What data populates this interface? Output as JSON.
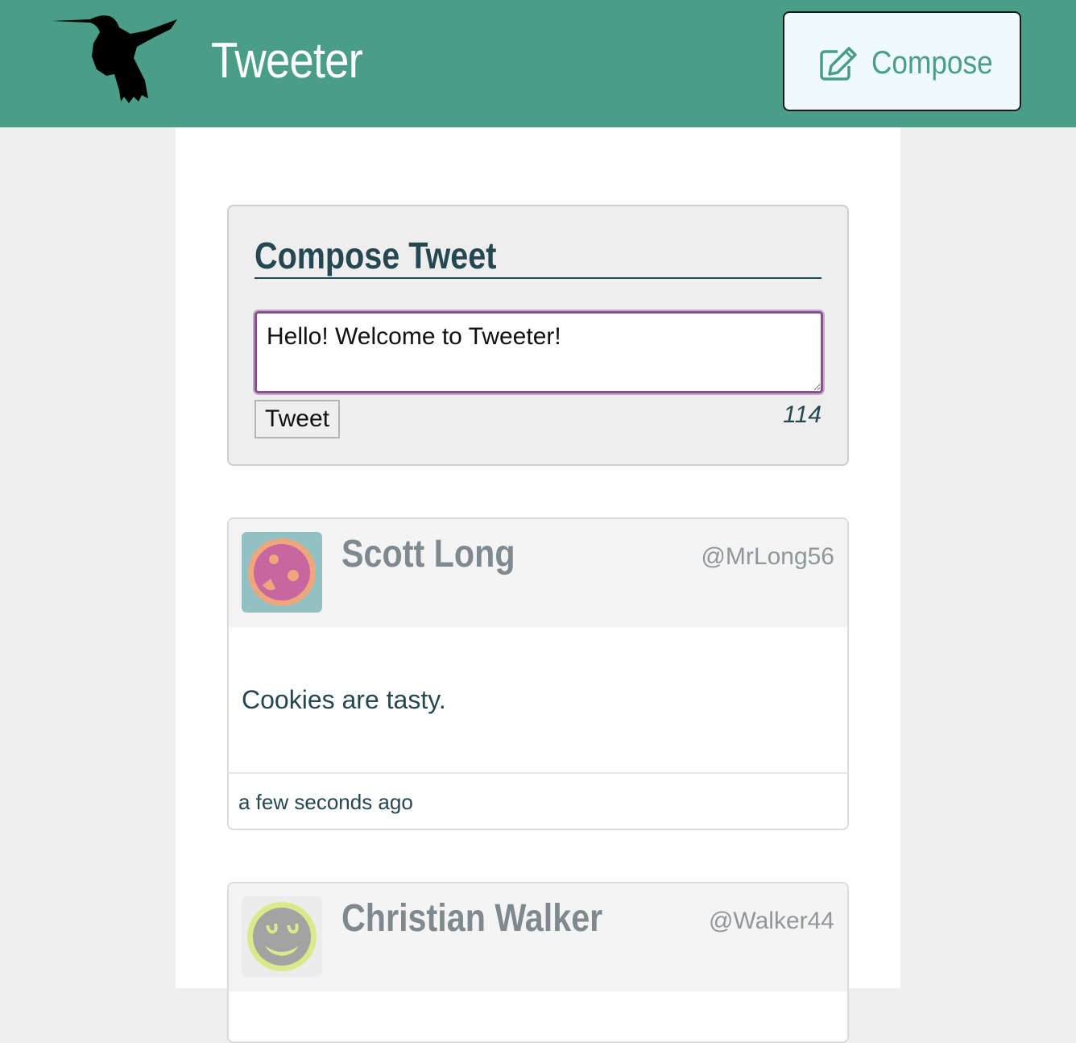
{
  "nav": {
    "brand": "Tweeter",
    "compose_label": "Compose"
  },
  "new_tweet": {
    "title": "Compose Tweet",
    "text": "Hello! Welcome to Tweeter!",
    "submit_label": "Tweet",
    "char_counter": "114"
  },
  "tweets": [
    {
      "name": "Scott Long",
      "handle": "@MrLong56",
      "content": "Cookies are tasty.",
      "time": "a few seconds ago"
    },
    {
      "name": "Christian Walker",
      "handle": "@Walker44"
    }
  ],
  "icons": {
    "logo": "hummingbird-icon",
    "compose": "edit-icon"
  },
  "colors": {
    "nav_bg": "#4a9e88",
    "accent_text": "#244751",
    "compose_bg": "#eefafd",
    "textarea_focus": "#8a4f8f"
  }
}
